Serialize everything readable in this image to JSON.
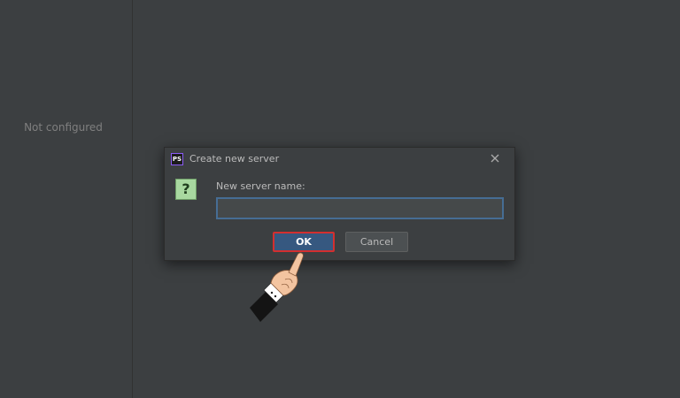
{
  "left_panel": {
    "empty_text": "Not configured"
  },
  "dialog": {
    "title": "Create new server",
    "app_icon_text": "PS",
    "field_label": "New server name:",
    "input_value": "",
    "input_placeholder": "",
    "ok_label": "OK",
    "cancel_label": "Cancel",
    "question_glyph": "?"
  },
  "colors": {
    "background": "#3c3f41",
    "ok_button": "#365880",
    "highlight": "#d32f2f",
    "question_icon": "#a8d8a0"
  },
  "icons": {
    "close": "close-icon",
    "question": "question-icon",
    "pointer": "pointing-hand-icon"
  }
}
